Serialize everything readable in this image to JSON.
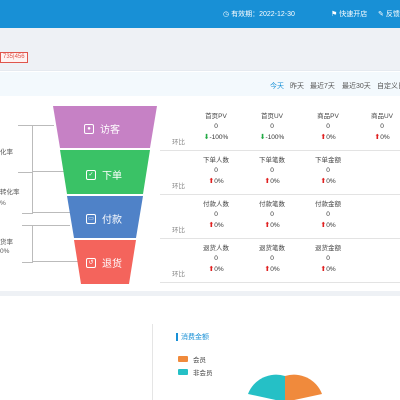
{
  "topbar": {
    "validity": "有效期：2022-12-30",
    "quick_open": "快速开店",
    "feedback": "反馈"
  },
  "badge": "735|456",
  "filters": [
    "今天",
    "昨天",
    "最近7天",
    "最近30天",
    "自定义日"
  ],
  "left_labels": [
    "化率",
    "转化率",
    "%",
    "货率",
    "0%"
  ],
  "funnel": [
    {
      "label": "访客",
      "color": "#c681c5",
      "icon": "user-icon"
    },
    {
      "label": "下单",
      "color": "#3ac266",
      "icon": "check-icon"
    },
    {
      "label": "付款",
      "color": "#4f82c8",
      "icon": "card-icon"
    },
    {
      "label": "退货",
      "color": "#f4645c",
      "icon": "return-icon"
    }
  ],
  "rows": [
    {
      "huanbi": "环比",
      "cols": [
        {
          "h": "首页PV",
          "v": "0",
          "dir": "down",
          "p": "-100%"
        },
        {
          "h": "首页UV",
          "v": "0",
          "dir": "down",
          "p": "-100%"
        },
        {
          "h": "商品PV",
          "v": "0",
          "dir": "up",
          "p": "0%"
        },
        {
          "h": "商品UV",
          "v": "0",
          "dir": "up",
          "p": "0%"
        }
      ]
    },
    {
      "huanbi": "环比",
      "cols": [
        {
          "h": "下单人数",
          "v": "0",
          "dir": "up",
          "p": "0%"
        },
        {
          "h": "下单笔数",
          "v": "0",
          "dir": "up",
          "p": "0%"
        },
        {
          "h": "下单金额",
          "v": "0",
          "dir": "up",
          "p": "0%"
        }
      ]
    },
    {
      "huanbi": "环比",
      "cols": [
        {
          "h": "付款人数",
          "v": "0",
          "dir": "up",
          "p": "0%"
        },
        {
          "h": "付款笔数",
          "v": "0",
          "dir": "up",
          "p": "0%"
        },
        {
          "h": "付款金额",
          "v": "0",
          "dir": "up",
          "p": "0%"
        }
      ]
    },
    {
      "huanbi": "环比",
      "cols": [
        {
          "h": "退货人数",
          "v": "0",
          "dir": "up",
          "p": "0%"
        },
        {
          "h": "退货笔数",
          "v": "0",
          "dir": "up",
          "p": "0%"
        },
        {
          "h": "退货金额",
          "v": "0",
          "dir": "up",
          "p": "0%"
        }
      ]
    }
  ],
  "consume": {
    "title": "消费金额",
    "legend": [
      {
        "label": "会员",
        "color": "#f08a3c"
      },
      {
        "label": "非会员",
        "color": "#25c0c6"
      }
    ]
  }
}
